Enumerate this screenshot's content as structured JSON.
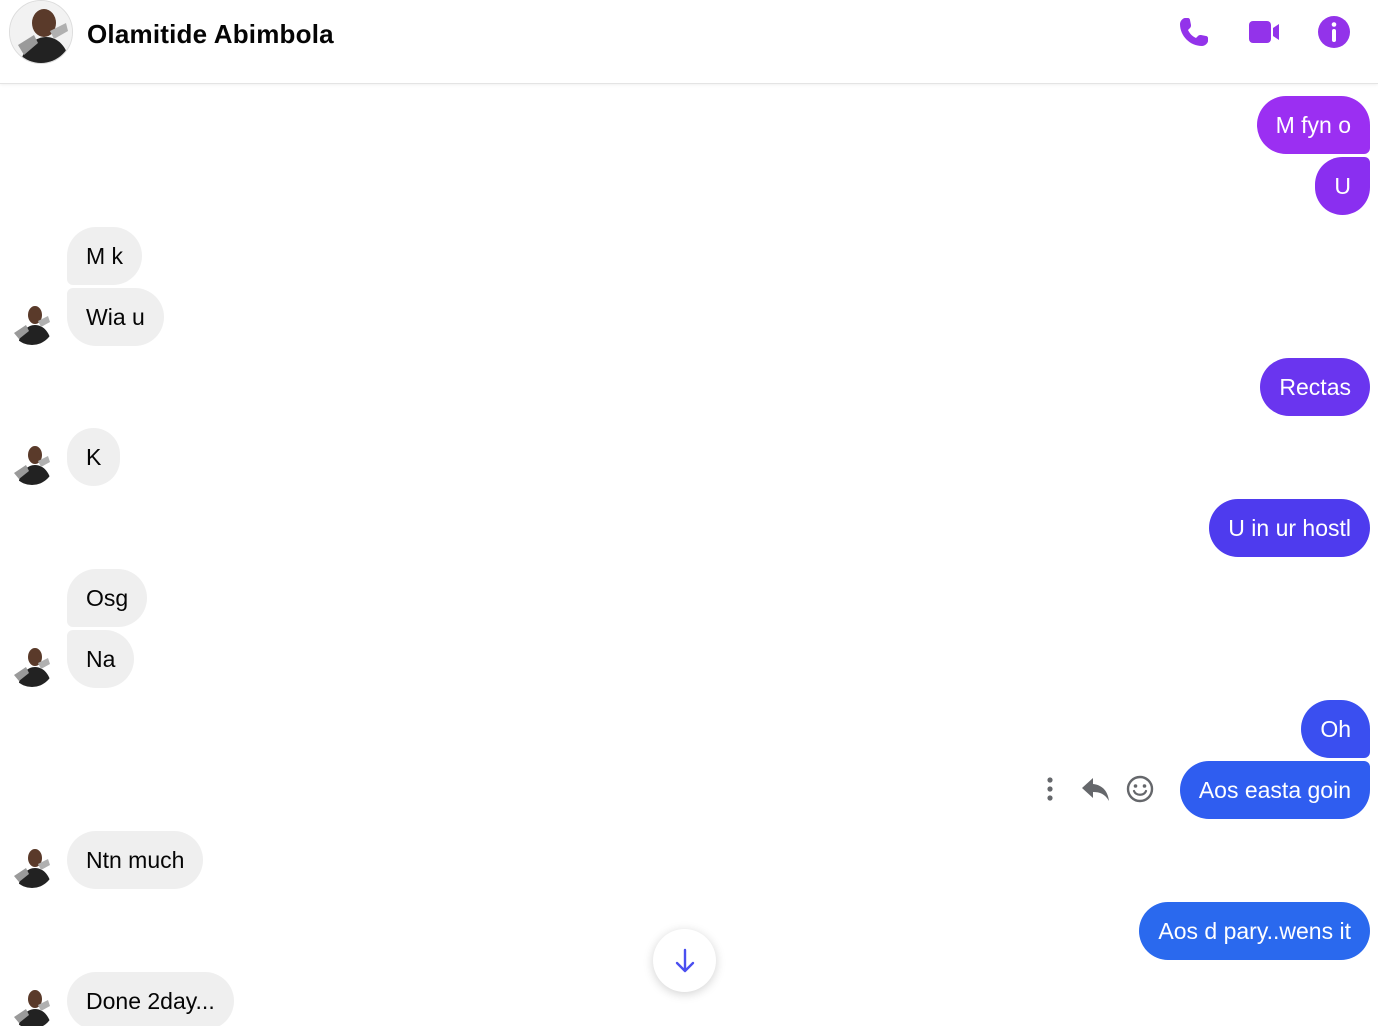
{
  "contact": {
    "name": "Olamitide Abimbola"
  },
  "header_icons": [
    "phone-icon",
    "video-camera-icon",
    "info-icon"
  ],
  "colors": {
    "accent": "#9333ea",
    "out_purple_1": "#9b2ff2",
    "out_purple_2": "#8a2ff0",
    "out_violet": "#6a35ef",
    "out_indigo": "#4e3bee",
    "out_blue_1": "#3a4ff0",
    "out_blue_2": "#2f5df0",
    "out_blue_3": "#2a69ee",
    "incoming_bg": "#efefef"
  },
  "messages": [
    {
      "side": "out",
      "text": "M fyn o"
    },
    {
      "side": "out",
      "text": "U"
    },
    {
      "side": "in",
      "text": "M k"
    },
    {
      "side": "in",
      "text": "Wia u"
    },
    {
      "side": "out",
      "text": "Rectas"
    },
    {
      "side": "in",
      "text": "K"
    },
    {
      "side": "out",
      "text": "U in ur hostl"
    },
    {
      "side": "in",
      "text": "Osg"
    },
    {
      "side": "in",
      "text": "Na"
    },
    {
      "side": "out",
      "text": "Oh"
    },
    {
      "side": "out",
      "text": "Aos easta goin"
    },
    {
      "side": "in",
      "text": "Ntn much"
    },
    {
      "side": "out",
      "text": "Aos d pary..wens it"
    },
    {
      "side": "in",
      "text": "Done 2day..."
    }
  ],
  "hover_actions": [
    "more-options-icon",
    "reply-icon",
    "react-emoji-icon"
  ],
  "scroll_button_icon": "arrow-down-icon"
}
